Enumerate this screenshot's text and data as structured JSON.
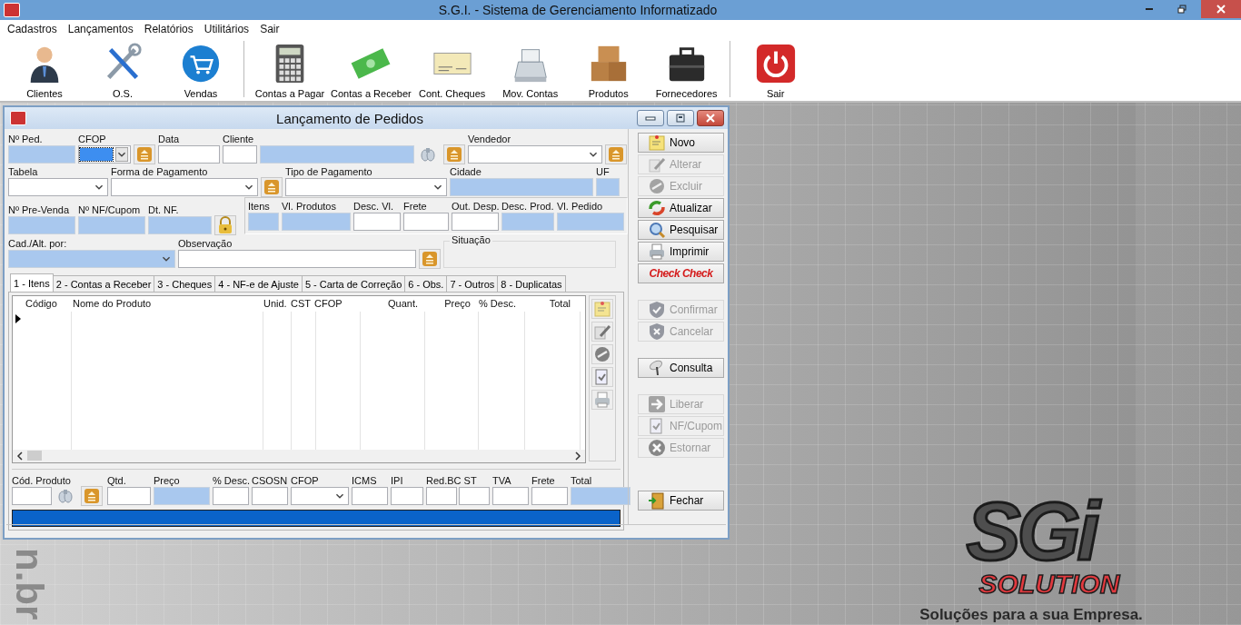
{
  "window": {
    "title": "S.G.I. - Sistema de Gerenciamento Informatizado"
  },
  "menu": [
    "Cadastros",
    "Lançamentos",
    "Relatórios",
    "Utilitários",
    "Sair"
  ],
  "toolbar_groups": [
    [
      "Clientes",
      "O.S.",
      "Vendas"
    ],
    [
      "Contas a Pagar",
      "Contas a Receber",
      "Cont. Cheques",
      "Mov. Contas",
      "Produtos",
      "Fornecedores"
    ],
    [
      "Sair"
    ]
  ],
  "child_window": {
    "title": "Lançamento de Pedidos",
    "rows": [
      {
        "items": [
          {
            "label": "Nº Ped.",
            "kind": "field",
            "readonly": true
          },
          {
            "label": "CFOP",
            "kind": "combo",
            "readonly": false,
            "focused": true
          },
          {
            "kind": "lookup"
          },
          {
            "label": "Data",
            "kind": "field",
            "readonly": false
          },
          {
            "label": "Cliente",
            "kind": "field",
            "readonly": false
          },
          {
            "kind": "field",
            "readonly": true
          },
          {
            "kind": "search"
          },
          {
            "kind": "lookup"
          },
          {
            "label": "Vendedor",
            "kind": "combo",
            "readonly": false,
            "focused": false
          },
          {
            "kind": "lookup"
          }
        ]
      },
      {
        "items": [
          {
            "label": "Tabela",
            "kind": "combo",
            "readonly": false,
            "focused": false
          },
          {
            "label": "Forma de Pagamento",
            "kind": "combo",
            "readonly": false,
            "focused": false
          },
          {
            "kind": "lookup"
          },
          {
            "label": "Tipo de Pagamento",
            "kind": "combo",
            "readonly": false,
            "focused": false
          },
          {
            "label": "Cidade",
            "kind": "field",
            "readonly": true
          },
          {
            "label": "UF",
            "kind": "field",
            "readonly": true
          }
        ]
      },
      {
        "items": [
          {
            "label": "Nº Pre-Venda",
            "kind": "field",
            "readonly": true
          },
          {
            "label": "Nº NF/Cupom",
            "kind": "field",
            "readonly": true
          },
          {
            "label": "Dt. NF.",
            "kind": "field",
            "readonly": true
          },
          {
            "kind": "lock"
          }
        ],
        "panel_items": [
          {
            "label": "Itens",
            "kind": "field",
            "readonly": true
          },
          {
            "label": "Vl. Produtos",
            "kind": "field",
            "readonly": true
          },
          {
            "label": "Desc. Vl.",
            "kind": "field",
            "readonly": false
          },
          {
            "label": "Frete",
            "kind": "field",
            "readonly": false
          },
          {
            "label": "Out. Desp.",
            "kind": "field",
            "readonly": false
          },
          {
            "label": "Desc. Prod.",
            "kind": "field",
            "readonly": true
          },
          {
            "label": "Vl. Pedido",
            "kind": "field",
            "readonly": true
          }
        ]
      },
      {
        "items": [
          {
            "label": "Cad./Alt. por:",
            "kind": "combo",
            "readonly": true,
            "focused": false
          },
          {
            "label": "Observação",
            "kind": "field",
            "readonly": false
          },
          {
            "kind": "lookup"
          },
          {
            "label": "Situação",
            "kind": "groupbox"
          }
        ]
      }
    ],
    "tabs": [
      {
        "label": "1 - Itens",
        "selected": true
      },
      {
        "label": "2 - Contas a Receber",
        "selected": false
      },
      {
        "label": "3 - Cheques",
        "selected": false
      },
      {
        "label": "4 - NF-e de Ajuste",
        "selected": false
      },
      {
        "label": "5 - Carta de Correção",
        "selected": false
      },
      {
        "label": "6 - Obs.",
        "selected": false
      },
      {
        "label": "7 - Outros",
        "selected": false
      },
      {
        "label": "8 - Duplicatas",
        "selected": false
      }
    ],
    "grid": {
      "columns": [
        "Código",
        "Nome do Produto",
        "Unid.",
        "CST",
        "CFOP",
        "Quant.",
        "Preço",
        "% Desc.",
        "Total"
      ]
    },
    "entry_items": [
      {
        "label": "Cód. Produto",
        "kind": "field",
        "readonly": false
      },
      {
        "kind": "search"
      },
      {
        "kind": "lookup"
      },
      {
        "label": "Qtd.",
        "kind": "field",
        "readonly": false
      },
      {
        "label": "Preço",
        "kind": "field",
        "readonly": true
      },
      {
        "label": "% Desc.",
        "kind": "field",
        "readonly": false
      },
      {
        "label": "CSOSN",
        "kind": "field",
        "readonly": false
      },
      {
        "label": "CFOP",
        "kind": "combo",
        "readonly": false,
        "focused": false
      },
      {
        "label": "ICMS",
        "kind": "field",
        "readonly": false
      },
      {
        "label": "IPI",
        "kind": "field",
        "readonly": false
      },
      {
        "label": "Red.BC ST",
        "kind": "double"
      },
      {
        "label": "TVA",
        "kind": "field",
        "readonly": false
      },
      {
        "label": "Frete",
        "kind": "field",
        "readonly": false
      },
      {
        "label": "Total",
        "kind": "field",
        "readonly": true
      }
    ],
    "progress": {
      "level": 1
    },
    "action_groups": [
      [
        {
          "label": "Novo",
          "disabled": false,
          "kind": "button"
        },
        {
          "label": "Alterar",
          "disabled": true,
          "kind": "button"
        },
        {
          "label": "Excluir",
          "disabled": true,
          "kind": "button"
        },
        {
          "label": "Atualizar",
          "disabled": false,
          "kind": "button"
        },
        {
          "label": "Pesquisar",
          "disabled": false,
          "kind": "button"
        },
        {
          "label": "Imprimir",
          "disabled": false,
          "kind": "button"
        },
        {
          "label": "Check Check",
          "disabled": false,
          "kind": "brand"
        }
      ],
      [
        {
          "label": "Confirmar",
          "disabled": true,
          "kind": "button"
        },
        {
          "label": "Cancelar",
          "disabled": true,
          "kind": "button"
        }
      ],
      [
        {
          "label": "Consulta",
          "disabled": false,
          "kind": "button"
        }
      ],
      [
        {
          "label": "Liberar",
          "disabled": true,
          "kind": "button"
        },
        {
          "label": "NF/Cupom",
          "disabled": true,
          "kind": "button"
        },
        {
          "label": "Estornar",
          "disabled": true,
          "kind": "button"
        }
      ],
      [
        {
          "label": "Fechar",
          "disabled": false,
          "kind": "button"
        }
      ]
    ]
  },
  "background": {
    "side_text": "n.br",
    "logo_big": "SGi",
    "logo_small": "SOLUTION",
    "tagline": "Soluções para a sua Empresa."
  }
}
